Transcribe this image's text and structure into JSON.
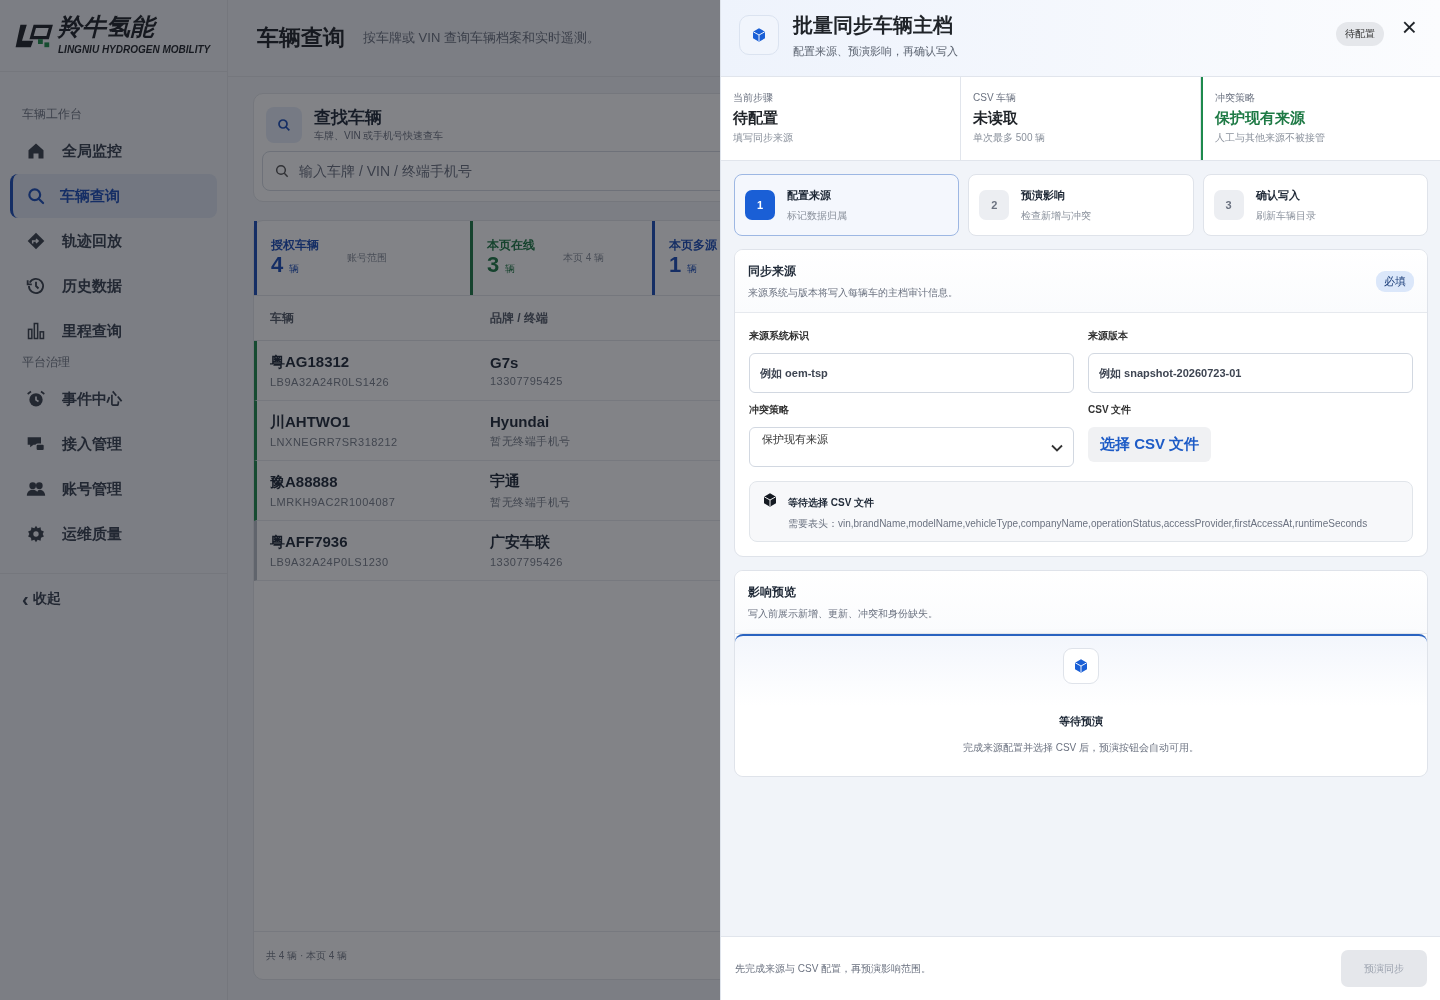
{
  "sidebar": {
    "logo": {
      "name": "羚牛氢能",
      "tagline": "LINGNIU HYDROGEN MOBILITY"
    },
    "groups": [
      {
        "title": "车辆工作台",
        "items": [
          {
            "label": "全局监控",
            "selected": false
          },
          {
            "label": "车辆查询",
            "selected": true
          },
          {
            "label": "轨迹回放",
            "selected": false
          },
          {
            "label": "历史数据",
            "selected": false
          },
          {
            "label": "里程查询",
            "selected": false
          }
        ]
      },
      {
        "title": "平台治理",
        "items": [
          {
            "label": "事件中心",
            "selected": false
          },
          {
            "label": "接入管理",
            "selected": false
          },
          {
            "label": "账号管理",
            "selected": false
          },
          {
            "label": "运维质量",
            "selected": false
          }
        ]
      }
    ],
    "collapse": {
      "icon": "‹",
      "label": "收起"
    }
  },
  "page": {
    "title": "车辆查询",
    "subtitle": "按车牌或 VIN 查询车辆档案和实时遥测。",
    "search_card": {
      "title": "查找车辆",
      "subtitle": "车牌、VIN 或手机号快速查车",
      "placeholder": "输入车牌 / VIN / 终端手机号"
    },
    "stats": [
      {
        "label": "授权车辆",
        "value": "4",
        "unit": "辆",
        "hint": "账号范围",
        "kind": "primary"
      },
      {
        "label": "本页在线",
        "value": "3",
        "unit": "辆",
        "hint": "本页 4 辆",
        "kind": "success"
      },
      {
        "label": "本页多源",
        "value": "1",
        "unit": "辆",
        "kind": "primary"
      }
    ],
    "table": {
      "columns": [
        "车辆",
        "品牌 / 终端"
      ],
      "rows": [
        {
          "plate": "粤AG18312",
          "vin": "LB9A32A24R0LS1426",
          "brand": "G7s",
          "terminal": "13307795425",
          "online": true
        },
        {
          "plate": "川AHTWO1",
          "vin": "LNXNEGRR7SR318212",
          "brand": "Hyundai",
          "terminal": "暂无终端手机号",
          "online": true
        },
        {
          "plate": "豫A88888",
          "vin": "LMRKH9AC2R1004087",
          "brand": "宇通",
          "terminal": "暂无终端手机号",
          "online": true
        },
        {
          "plate": "粤AFF7936",
          "vin": "LB9A32A24P0LS1230",
          "brand": "广安车联",
          "terminal": "13307795426",
          "online": false
        }
      ],
      "footer": "共 4 辆 · 本页 4 辆"
    }
  },
  "drawer": {
    "title": "批量同步车辆主档",
    "subtitle": "配置来源、预演影响，再确认写入",
    "status": "待配置",
    "close": "×",
    "summary": [
      {
        "label": "当前步骤",
        "value": "待配置",
        "hint": "填写同步来源",
        "highlight": false
      },
      {
        "label": "CSV 车辆",
        "value": "未读取",
        "hint": "单次最多 500 辆",
        "highlight": false
      },
      {
        "label": "冲突策略",
        "value": "保护现有来源",
        "hint": "人工与其他来源不被接管",
        "highlight": true
      }
    ],
    "steps": [
      {
        "number": "1",
        "title": "配置来源",
        "hint": "标记数据归属",
        "selected": true
      },
      {
        "number": "2",
        "title": "预演影响",
        "hint": "检查新增与冲突",
        "selected": false
      },
      {
        "number": "3",
        "title": "确认写入",
        "hint": "刷新车辆目录",
        "selected": false
      }
    ],
    "source": {
      "title": "同步来源",
      "subtitle": "来源系统与版本将写入每辆车的主档审计信息。",
      "badge": "必填",
      "system_field": {
        "label": "来源系统标识",
        "placeholder": "例如 oem-tsp"
      },
      "version_field": {
        "label": "来源版本",
        "placeholder": "例如 snapshot-20260723-01"
      },
      "conflict_select": {
        "label": "冲突策略",
        "value": "保护现有来源"
      },
      "csv": {
        "label": "CSV 文件",
        "button": "选择 CSV 文件"
      },
      "notice": {
        "title": "等待选择 CSV 文件",
        "text": "需要表头：vin,brandName,modelName,vehicleType,companyName,operationStatus,accessProvider,firstAccessAt,runtimeSeconds"
      }
    },
    "preview": {
      "title": "影响预览",
      "subtitle": "写入前展示新增、更新、冲突和身份缺失。",
      "empty_title": "等待预演",
      "empty_text": "完成来源配置并选择 CSV 后，预演按钮会自动可用。"
    },
    "footer": {
      "hint": "先完成来源与 CSV 配置，再预演影响范围。",
      "button": "预演同步",
      "disabled": true
    }
  }
}
